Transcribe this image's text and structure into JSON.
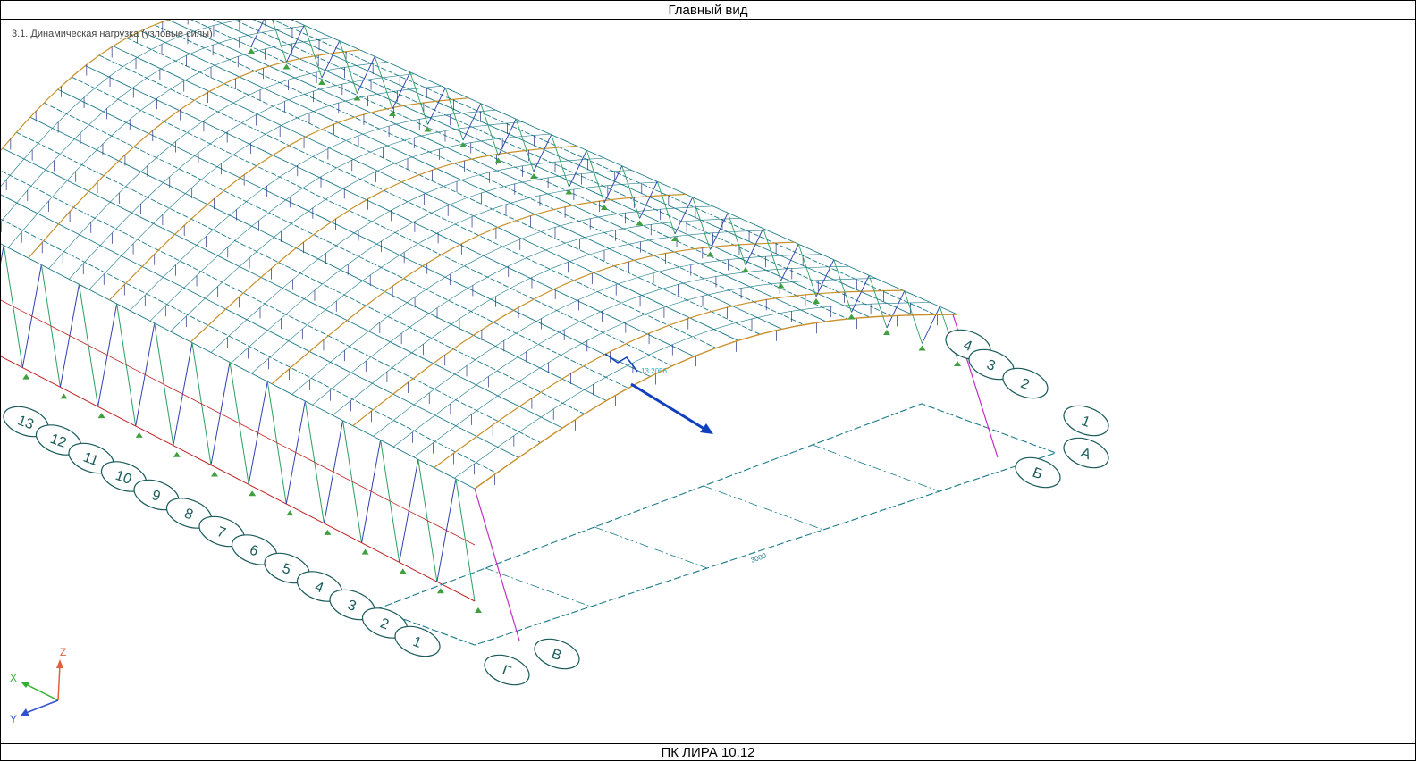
{
  "window": {
    "title": "Главный вид"
  },
  "viewport": {
    "load_case": "3.1. Динамическая нагрузка (узловые силы)",
    "dimension_main": "3000",
    "load_value": "13.2056",
    "axes_letters": [
      "А",
      "Б",
      "В",
      "Г"
    ],
    "axes_numbers_left": [
      "13",
      "12",
      "11",
      "10",
      "9",
      "8",
      "7",
      "6",
      "5",
      "4",
      "3",
      "2",
      "1"
    ],
    "axes_numbers_right": [
      "4",
      "3",
      "2",
      "1"
    ]
  },
  "triad": {
    "x": "X",
    "y": "Y",
    "z": "Z"
  },
  "status": {
    "app_name": "ПК ЛИРА 10.12"
  },
  "colors": {
    "grid": "#1a7a8a",
    "purlin": "#c8902a",
    "bracing_blue": "#3040b0",
    "bracing_green": "#2aa060",
    "bracing_red": "#c02020",
    "load_arrow": "#1040c0",
    "axis_label": "#1a5a5a"
  }
}
